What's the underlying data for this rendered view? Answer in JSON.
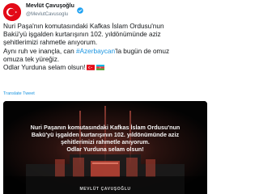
{
  "author": {
    "display_name": "Mevlüt Çavuşoğlu",
    "handle": "@MevlutCavusoglu"
  },
  "tweet": {
    "lines": [
      {
        "text": "Nuri Paşa'nın komutasındaki Kafkas İslam Ordusu'nun"
      },
      {
        "text": "Bakü'yü işgalden kurtarışının 102. yıldönümünde aziz"
      },
      {
        "text": "şehitlerimizi rahmetle anıyorum."
      },
      {
        "before": "Aynı ruh ve inançla, can ",
        "hashtag": "#Azerbaycan",
        "after": "'la bugün de omuz"
      },
      {
        "text": "omuza tek yüreğiz."
      },
      {
        "text": "Odlar Yurduna selam olsun!"
      }
    ],
    "flags": [
      "flag-turkey-icon",
      "flag-azerbaijan-icon"
    ],
    "translate_label": "Translate Tweet"
  },
  "media": {
    "caption_lines": [
      "Nuri Paşanın komutasındaki Kafkas İslam Ordusu'nun",
      "Bakü'yü işgalden kurtarışının 102. yıldönümünde aziz",
      "şehitlerimizi rahmetle anıyorum.",
      "Odlar Yurduna selam olsun!"
    ],
    "watermark": "MEVLÜT ÇAVUŞOĞLU"
  },
  "colors": {
    "text": "#14171a",
    "secondary": "#657786",
    "link": "#1b95e0",
    "turkey_red": "#e30a17",
    "verified_blue": "#1da1f2"
  }
}
